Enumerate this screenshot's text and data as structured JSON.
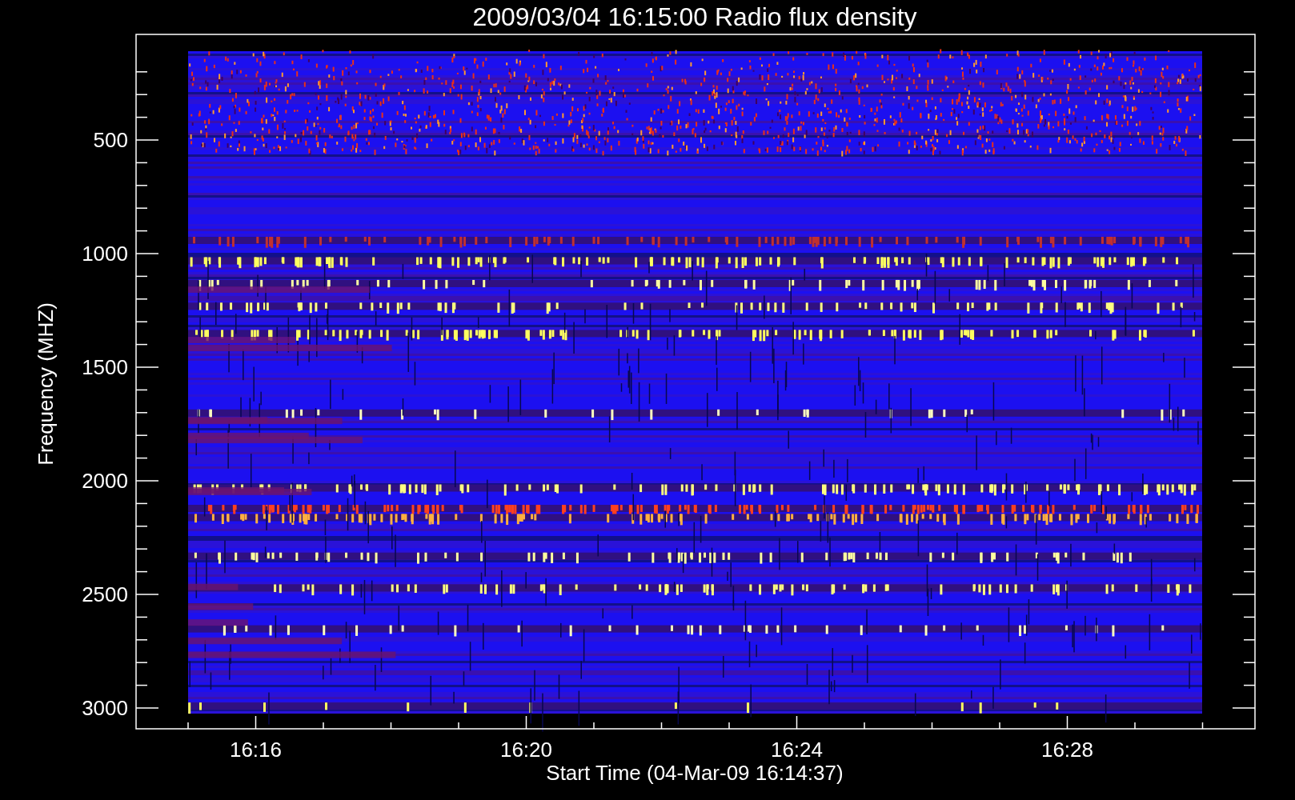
{
  "title": "2009/03/04 16:15:00 Radio flux density",
  "y_axis": {
    "label": "Frequency (MHZ)",
    "ticks": [
      "500",
      "1000",
      "1500",
      "2000",
      "2500",
      "3000"
    ]
  },
  "x_axis": {
    "label": "Start Time (04-Mar-09 16:14:37)",
    "ticks": [
      "16:16",
      "16:20",
      "16:24",
      "16:28"
    ]
  }
}
